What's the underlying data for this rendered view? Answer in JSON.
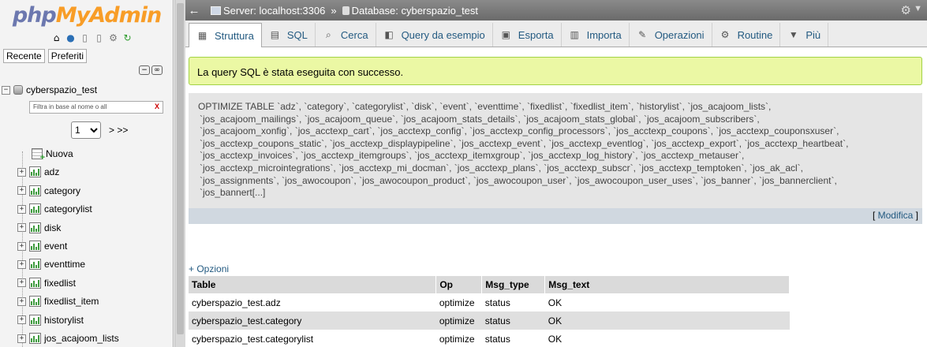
{
  "nav": {
    "logo_php": "php",
    "logo_my": "My",
    "logo_admin": "Admin",
    "recent_label": "Recente",
    "favorites_label": "Preferiti",
    "db_name": "cyberspazio_test",
    "filter_placeholder": "Filtra in base al nome o all",
    "filter_clear": "X",
    "page_value": "1",
    "page_next": "> >>",
    "new_label": "Nuova",
    "tables": [
      "adz",
      "category",
      "categorylist",
      "disk",
      "event",
      "eventtime",
      "fixedlist",
      "fixedlist_item",
      "historylist",
      "jos_acajoom_lists"
    ]
  },
  "topbar": {
    "back": "←",
    "server": "Server: localhost:3306",
    "separator": "»",
    "database": "Database: cyberspazio_test"
  },
  "tabs": [
    {
      "label": "Struttura",
      "icon": "structure-icon"
    },
    {
      "label": "SQL",
      "icon": "sql-icon"
    },
    {
      "label": "Cerca",
      "icon": "search-icon"
    },
    {
      "label": "Query da esempio",
      "icon": "query-icon"
    },
    {
      "label": "Esporta",
      "icon": "export-icon"
    },
    {
      "label": "Importa",
      "icon": "import-icon"
    },
    {
      "label": "Operazioni",
      "icon": "wrench-icon"
    },
    {
      "label": "Routine",
      "icon": "routine-icon"
    },
    {
      "label": "Più",
      "icon": "caret-down-icon"
    }
  ],
  "message": {
    "success": "La query SQL è stata eseguita con successo."
  },
  "sql": {
    "lines": [
      "OPTIMIZE TABLE `adz`, `category`, `categorylist`, `disk`, `event`, `eventtime`, `fixedlist`, `fixedlist_item`, `historylist`, `jos_acajoom_lists`,",
      "`jos_acajoom_mailings`, `jos_acajoom_queue`, `jos_acajoom_stats_details`, `jos_acajoom_stats_global`, `jos_acajoom_subscribers`,",
      "`jos_acajoom_xonfig`, `jos_acctexp_cart`, `jos_acctexp_config`, `jos_acctexp_config_processors`, `jos_acctexp_coupons`, `jos_acctexp_couponsxuser`,",
      "`jos_acctexp_coupons_static`, `jos_acctexp_displaypipeline`, `jos_acctexp_event`, `jos_acctexp_eventlog`, `jos_acctexp_export`, `jos_acctexp_heartbeat`,",
      "`jos_acctexp_invoices`, `jos_acctexp_itemgroups`, `jos_acctexp_itemxgroup`, `jos_acctexp_log_history`, `jos_acctexp_metauser`,",
      "`jos_acctexp_microintegrations`, `jos_acctexp_mi_docman`, `jos_acctexp_plans`, `jos_acctexp_subscr`, `jos_acctexp_temptoken`, `jos_ak_acl`,",
      "`jos_assignments`, `jos_awocoupon`, `jos_awocoupon_product`, `jos_awocoupon_user`, `jos_awocoupon_user_uses`, `jos_banner`, `jos_bannerclient`,",
      "`jos_bannert[...]"
    ],
    "edit_open": "[",
    "edit_label": "Modifica",
    "edit_close": "]"
  },
  "options_label": "+ Opzioni",
  "results": {
    "headers": [
      "Table",
      "Op",
      "Msg_type",
      "Msg_text"
    ],
    "rows": [
      [
        "cyberspazio_test.adz",
        "optimize",
        "status",
        "OK"
      ],
      [
        "cyberspazio_test.category",
        "optimize",
        "status",
        "OK"
      ],
      [
        "cyberspazio_test.categorylist",
        "optimize",
        "status",
        "OK"
      ]
    ]
  }
}
